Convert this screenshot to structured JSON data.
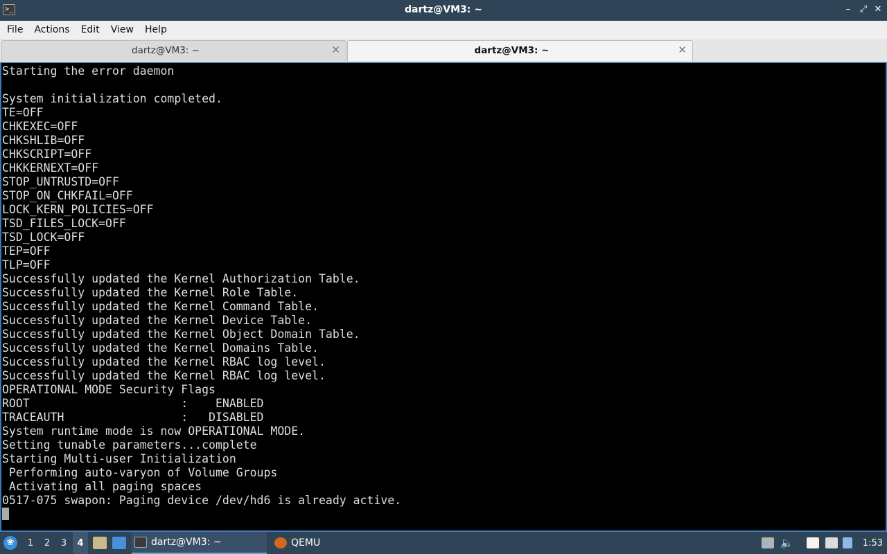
{
  "window": {
    "title": "dartz@VM3: ~",
    "app_icon_glyph": ">_"
  },
  "window_controls": {
    "minimize": "–",
    "restore": "⤢",
    "close": "✕"
  },
  "menubar": {
    "items": [
      "File",
      "Actions",
      "Edit",
      "View",
      "Help"
    ]
  },
  "tabs": [
    {
      "label": "dartz@VM3: ~",
      "active": false,
      "close": "✕"
    },
    {
      "label": "dartz@VM3: ~",
      "active": true,
      "close": "✕"
    }
  ],
  "terminal": {
    "lines": [
      "Starting the error daemon",
      "",
      "System initialization completed.",
      "TE=OFF",
      "CHKEXEC=OFF",
      "CHKSHLIB=OFF",
      "CHKSCRIPT=OFF",
      "CHKKERNEXT=OFF",
      "STOP_UNTRUSTD=OFF",
      "STOP_ON_CHKFAIL=OFF",
      "LOCK_KERN_POLICIES=OFF",
      "TSD_FILES_LOCK=OFF",
      "TSD_LOCK=OFF",
      "TEP=OFF",
      "TLP=OFF",
      "Successfully updated the Kernel Authorization Table.",
      "Successfully updated the Kernel Role Table.",
      "Successfully updated the Kernel Command Table.",
      "Successfully updated the Kernel Device Table.",
      "Successfully updated the Kernel Object Domain Table.",
      "Successfully updated the Kernel Domains Table.",
      "Successfully updated the Kernel RBAC log level.",
      "Successfully updated the Kernel RBAC log level.",
      "OPERATIONAL MODE Security Flags",
      "ROOT                      :    ENABLED",
      "TRACEAUTH                 :   DISABLED",
      "System runtime mode is now OPERATIONAL MODE.",
      "Setting tunable parameters...complete",
      "Starting Multi-user Initialization",
      " Performing auto-varyon of Volume Groups",
      " Activating all paging spaces",
      "0517-075 swapon: Paging device /dev/hd6 is already active."
    ]
  },
  "taskbar": {
    "workspaces": [
      "1",
      "2",
      "3",
      "4"
    ],
    "active_workspace": "4",
    "tasks": [
      {
        "label": "dartz@VM3: ~",
        "icon": "terminal-icon",
        "active": true
      },
      {
        "label": "QEMU",
        "icon": "qemu-icon",
        "active": false
      }
    ],
    "clock": "1:53"
  },
  "colors": {
    "titlebar_bg": "#2f4456",
    "terminal_bg": "#000000",
    "terminal_fg": "#dedede",
    "accent": "#3d79b5"
  }
}
